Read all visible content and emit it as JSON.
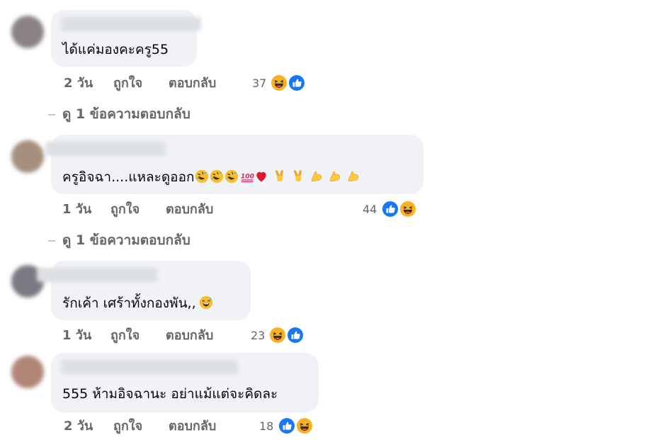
{
  "comments": [
    {
      "text": "ได้แค่มองคะครู55",
      "age": "2 วัน",
      "like_label": "ถูกใจ",
      "reply_label": "ตอบกลับ",
      "reaction_count": "37"
    },
    {
      "text": "ครูอิจฉา....แหละดูออก",
      "age": "1 วัน",
      "like_label": "ถูกใจ",
      "reply_label": "ตอบกลับ",
      "reaction_count": "44"
    },
    {
      "text": "รักเค้า เศร้าทั้งกองพัน,,",
      "age": "1 วัน",
      "like_label": "ถูกใจ",
      "reply_label": "ตอบกลับ",
      "reaction_count": "23"
    },
    {
      "text": "555 ห้ามอิจฉานะ อย่าแม้แต่จะคิดละ",
      "age": "2 วัน",
      "like_label": "ถูกใจ",
      "reply_label": "ตอบกลับ",
      "reaction_count": "18"
    }
  ],
  "view_replies": [
    "ดู 1 ข้อความตอบกลับ",
    "ดู 1 ข้อความตอบกลับ"
  ],
  "colors": {
    "bubble": "#f0f2f5",
    "meta_text": "#65676b",
    "like_blue": "#1877f2",
    "haha_yellow": "#f7b125"
  },
  "icons": {
    "like": "like-reaction-icon",
    "haha": "haha-reaction-icon"
  }
}
